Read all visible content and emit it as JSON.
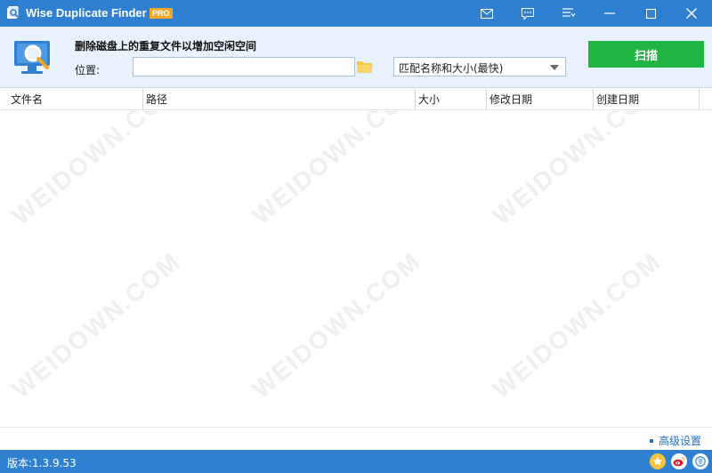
{
  "window": {
    "title": "Wise Duplicate Finder",
    "badge": "PRO",
    "buttons": [
      "mail-icon",
      "feedback-icon",
      "menu-icon",
      "minimize-icon",
      "maximize-icon",
      "close-icon"
    ]
  },
  "header": {
    "title": "删除磁盘上的重复文件以增加空闲空间",
    "location_label": "位置:",
    "location_value": "",
    "match_mode": "匹配名称和大小(最快)",
    "scan_button": "扫描"
  },
  "table": {
    "columns": [
      "文件名",
      "路径",
      "大小",
      "修改日期",
      "创建日期"
    ],
    "rows": []
  },
  "footer": {
    "advanced_link": "高级设置",
    "version": "版本:1.3.9.53"
  },
  "watermark": "WEIDOWN.COM",
  "colors": {
    "titlebar": "#2f80d1",
    "header_bg": "#e8f2fc",
    "scan_button": "#20b443",
    "pro_badge": "#f6a623",
    "link": "#1f6fbf"
  }
}
